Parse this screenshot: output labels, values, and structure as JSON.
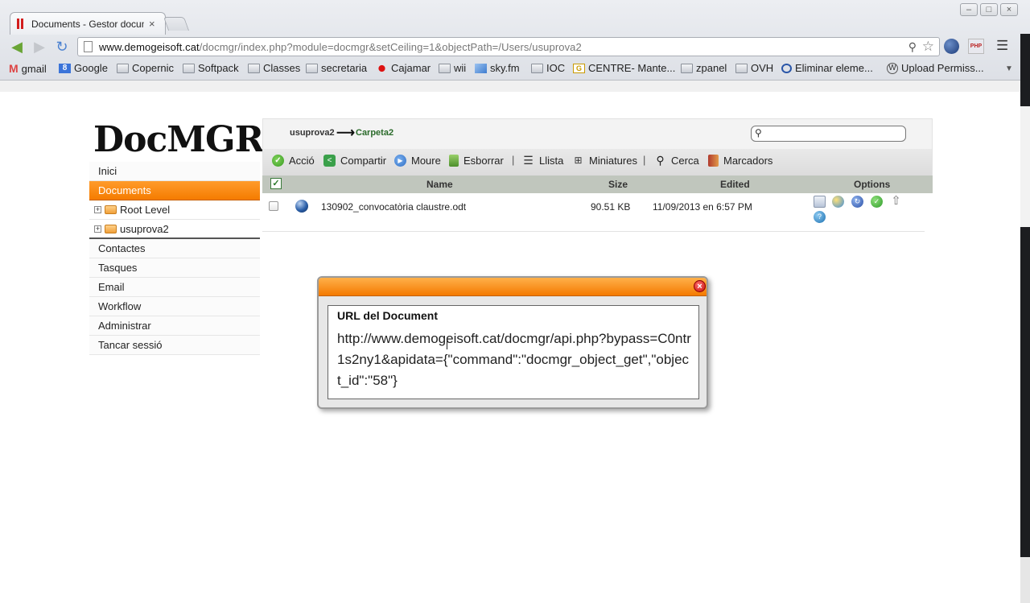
{
  "browser": {
    "tab_title": "Documents - Gestor docum",
    "tab_close": "×",
    "url_host": "www.demogeisoft.cat",
    "url_path": "/docmgr/index.php?module=docmgr&setCeiling=1&objectPath=/Users/usuprova2",
    "bookmarks": [
      {
        "label": "gmail",
        "icon": "gmail-icon"
      },
      {
        "label": "Google",
        "icon": "google-icon"
      },
      {
        "label": "Copernic",
        "icon": "folder-icon"
      },
      {
        "label": "Softpack",
        "icon": "folder-icon"
      },
      {
        "label": "Classes",
        "icon": "folder-icon"
      },
      {
        "label": "secretaria",
        "icon": "folder-icon"
      },
      {
        "label": "Cajamar",
        "icon": "rose-icon"
      },
      {
        "label": "wii",
        "icon": "folder-icon"
      },
      {
        "label": "sky.fm",
        "icon": "sky-icon"
      },
      {
        "label": "IOC",
        "icon": "folder-icon"
      },
      {
        "label": "CENTRE- Mante...",
        "icon": "centre-icon"
      },
      {
        "label": "zpanel",
        "icon": "folder-icon"
      },
      {
        "label": "OVH",
        "icon": "folder-icon"
      },
      {
        "label": "Eliminar eleme...",
        "icon": "o-icon"
      },
      {
        "label": "Upload Permiss...",
        "icon": "wordpress-icon"
      }
    ],
    "ext_php_label": "PHP"
  },
  "app": {
    "logo": "DocMGR",
    "sidebar": {
      "items_top": [
        "Inici",
        "Documents"
      ],
      "tree": [
        "Root Level",
        "usuprova2"
      ],
      "items_bottom": [
        "Contactes",
        "Tasques",
        "Email",
        "Workflow",
        "Administrar",
        "Tancar sessió"
      ]
    },
    "breadcrumb": [
      "usuprova2",
      "Carpeta2"
    ],
    "search_placeholder": "",
    "actions": [
      "Acció",
      "Compartir",
      "Moure",
      "Esborrar",
      "Llista",
      "Miniatures",
      "Cerca",
      "Marcadors"
    ],
    "table": {
      "headers": {
        "name": "Name",
        "size": "Size",
        "edited": "Edited",
        "options": "Options"
      },
      "rows": [
        {
          "name": "130902_convocatòria claustre.odt",
          "size": "90.51 KB",
          "edited": "11/09/2013 en 6:57 PM"
        }
      ]
    },
    "modal": {
      "heading": "URL del Document",
      "url_text": "http://www.demogeisoft.cat/docmgr/api.php?bypass=C0ntr1s2ny1&apidata={\"command\":\"docmgr_object_get\",\"object_id\":\"58\"}",
      "close": "×"
    }
  },
  "colors": {
    "accent_orange": "#f57c00",
    "table_header": "#c0c6bd"
  }
}
